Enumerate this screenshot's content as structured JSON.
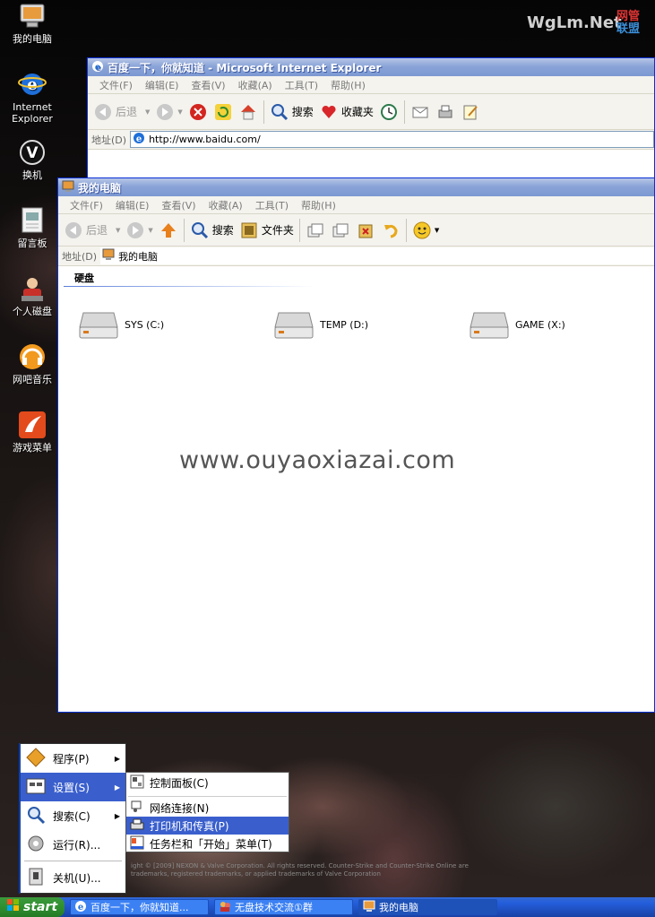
{
  "watermark": {
    "brand": "WgLm.Net",
    "cn_top": "网管",
    "cn_bottom": "联盟"
  },
  "desktop_icons": [
    {
      "label": "我的电脑",
      "icon": "computer-icon"
    },
    {
      "label": "Internet Explorer",
      "icon": "ie-icon"
    },
    {
      "label": "换机",
      "icon": "v-icon"
    },
    {
      "label": "留言板",
      "icon": "note-icon"
    },
    {
      "label": "个人磁盘",
      "icon": "user-disk-icon"
    },
    {
      "label": "网吧音乐",
      "icon": "music-icon"
    },
    {
      "label": "游戏菜单",
      "icon": "game-menu-icon"
    }
  ],
  "ie_window": {
    "title": "百度一下，你就知道 - Microsoft Internet Explorer",
    "menu": [
      "文件(F)",
      "编辑(E)",
      "查看(V)",
      "收藏(A)",
      "工具(T)",
      "帮助(H)"
    ],
    "back": "后退",
    "search": "搜索",
    "favorites": "收藏夹",
    "address_label": "地址(D)",
    "address_value": "http://www.baidu.com/"
  },
  "explorer_window": {
    "title": "我的电脑",
    "menu": [
      "文件(F)",
      "编辑(E)",
      "查看(V)",
      "收藏(A)",
      "工具(T)",
      "帮助(H)"
    ],
    "back": "后退",
    "search": "搜索",
    "folders": "文件夹",
    "address_label": "地址(D)",
    "address_value": "我的电脑",
    "section": "硬盘",
    "drives": [
      "SYS (C:)",
      "TEMP (D:)",
      "GAME (X:)"
    ]
  },
  "overlay_text": "www.ouyaoxiazai.com",
  "credit_text": "ight © [2009] NEXON & Valve Corporation. All rights reserved. Counter-Strike and Counter-Strike Online are trademarks, registered trademarks, or applied trademarks of Valve Corporation",
  "start_menu": {
    "items": [
      {
        "label": "程序(P)",
        "arrow": "▶"
      },
      {
        "label": "设置(S)",
        "arrow": "▶"
      },
      {
        "label": "搜索(C)",
        "arrow": "▶"
      },
      {
        "label": "运行(R)...",
        "arrow": ""
      },
      {
        "label": "关机(U)...",
        "arrow": ""
      }
    ],
    "submenu": [
      "控制面板(C)",
      "网络连接(N)",
      "打印机和传真(P)",
      "任务栏和「开始」菜单(T)"
    ]
  },
  "taskbar": {
    "start": "start",
    "buttons": [
      "百度一下，你就知道...",
      "无盘技术交流①群",
      "我的电脑"
    ]
  }
}
